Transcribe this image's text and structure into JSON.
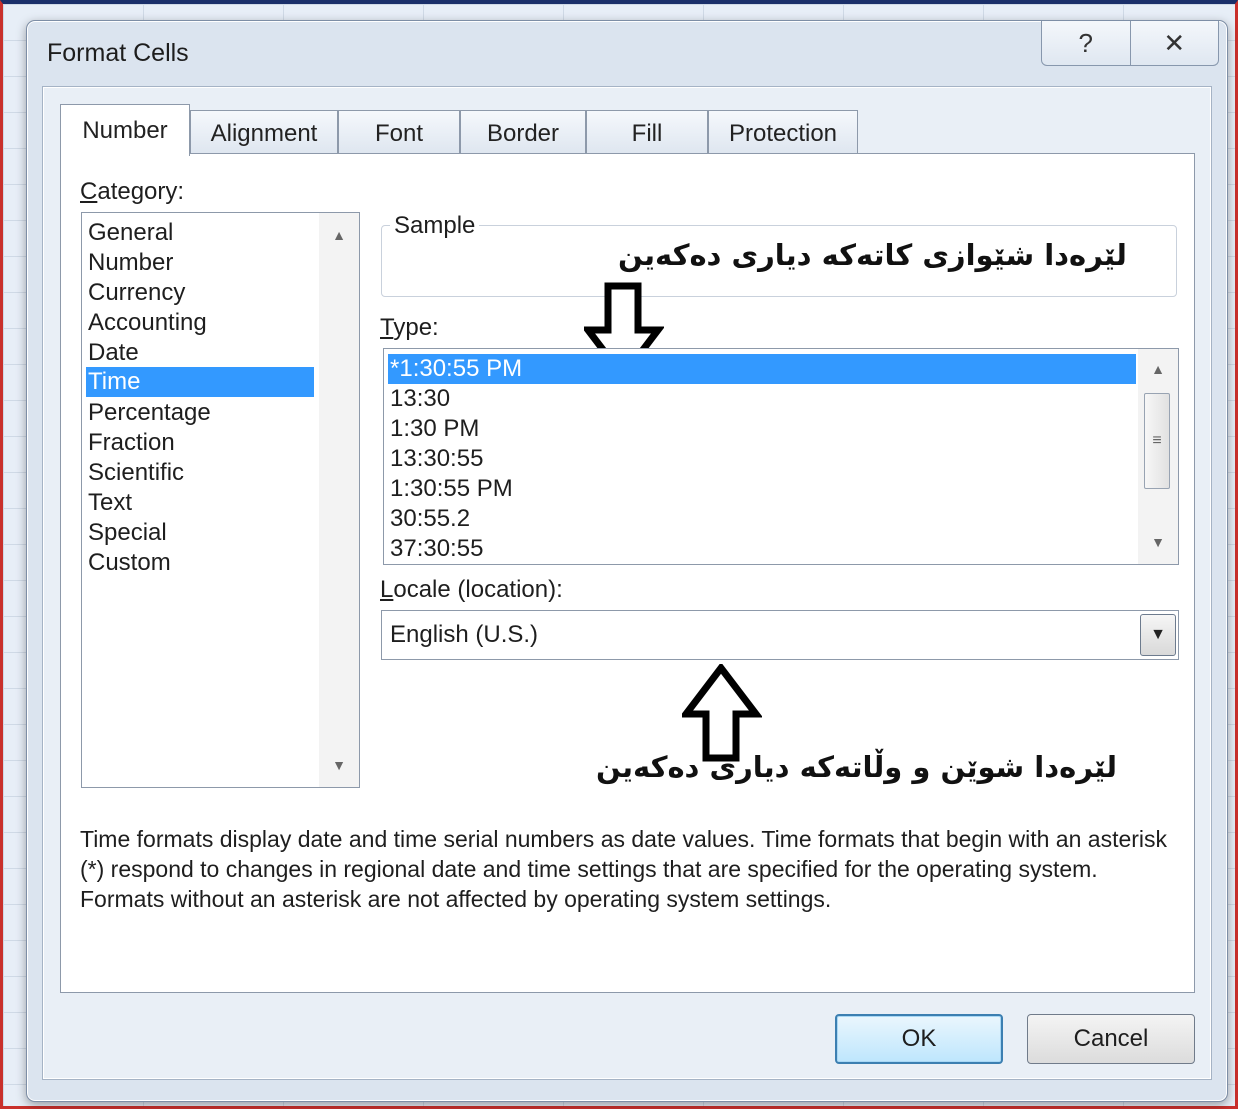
{
  "window": {
    "title": "Format Cells",
    "help_glyph": "?",
    "close_glyph": "✕"
  },
  "tabs": [
    "Number",
    "Alignment",
    "Font",
    "Border",
    "Fill",
    "Protection"
  ],
  "category": {
    "label_first": "C",
    "label_rest": "ategory:",
    "items": [
      "General",
      "Number",
      "Currency",
      "Accounting",
      "Date",
      "Time",
      "Percentage",
      "Fraction",
      "Scientific",
      "Text",
      "Special",
      "Custom"
    ],
    "selected": "Time"
  },
  "sample": {
    "legend": "Sample"
  },
  "type": {
    "label_first": "T",
    "label_rest": "ype:",
    "items": [
      "*1:30:55 PM",
      "13:30",
      "1:30 PM",
      "13:30:55",
      "1:30:55 PM",
      "30:55.2",
      "37:30:55"
    ],
    "selected": "*1:30:55 PM"
  },
  "locale": {
    "label_first": "L",
    "label_rest": "ocale (location):",
    "value": "English (U.S.)"
  },
  "annotations": {
    "top": "لێرەدا شێوازی کاتەکە دیاری دەکەین",
    "bottom": "لێرەدا شوێن و وڵاتەکە دیاری دەکەین"
  },
  "description": "Time formats display date and time serial numbers as date values.  Time formats that begin with an asterisk (*) respond to changes in regional date and time settings that are specified for the operating system. Formats without an asterisk are not affected by operating system settings.",
  "buttons": {
    "ok": "OK",
    "cancel": "Cancel"
  }
}
